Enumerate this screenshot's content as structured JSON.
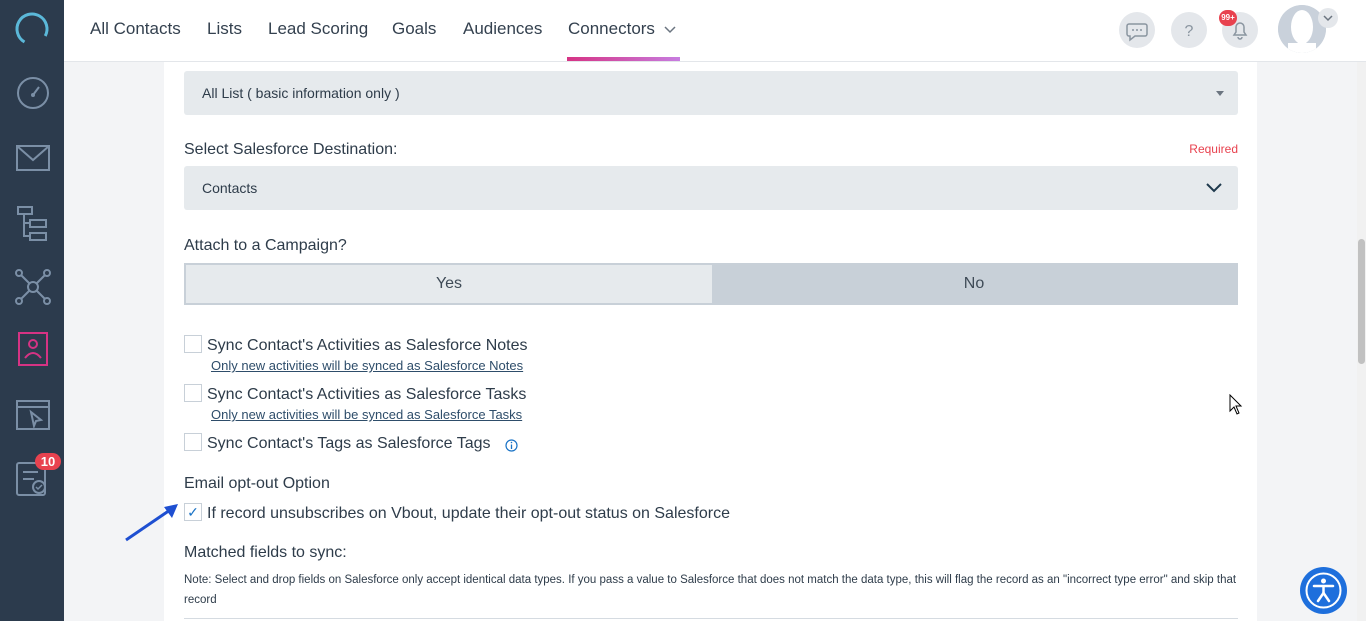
{
  "sidebar": {
    "items": [
      {
        "icon": "dashboard-icon"
      },
      {
        "icon": "email-icon"
      },
      {
        "icon": "workflow-icon"
      },
      {
        "icon": "network-icon"
      },
      {
        "icon": "contacts-icon"
      },
      {
        "icon": "landing-page-icon"
      },
      {
        "icon": "tasks-icon"
      }
    ],
    "tasks_badge": "10"
  },
  "topnav": {
    "tabs": [
      "All Contacts",
      "Lists",
      "Lead Scoring",
      "Goals",
      "Audiences",
      "Connectors"
    ],
    "active_tab": "Connectors",
    "notification_badge": "99+"
  },
  "form": {
    "list_select_value": "All List ( basic information only )",
    "destination_label": "Select Salesforce Destination:",
    "required_label": "Required",
    "destination_value": "Contacts",
    "campaign_label": "Attach to a Campaign?",
    "campaign_yes": "Yes",
    "campaign_no": "No",
    "options": [
      {
        "label": "Sync Contact's Activities as Salesforce Notes",
        "note": "Only new activities will be synced as Salesforce Notes",
        "checked": false
      },
      {
        "label": "Sync Contact's Activities as Salesforce Tasks",
        "note": "Only new activities will be synced as Salesforce Tasks",
        "checked": false
      },
      {
        "label": "Sync Contact's Tags as Salesforce Tags",
        "note": "",
        "checked": false
      }
    ],
    "optout_title": "Email opt-out Option",
    "optout_label": "If record unsubscribes on Vbout, update their opt-out status on Salesforce",
    "optout_checked": true,
    "matched_label": "Matched fields to sync:",
    "matched_note": "Note: Select and drop fields on Salesforce only accept identical data types. If you pass a value to Salesforce that does not match the data type, this will flag the record as an \"incorrect type error\" and skip that record"
  },
  "colors": {
    "sidebar": "#2c3b4d",
    "accent": "#d63384",
    "required": "#e8424f",
    "link": "#1a73c6"
  }
}
